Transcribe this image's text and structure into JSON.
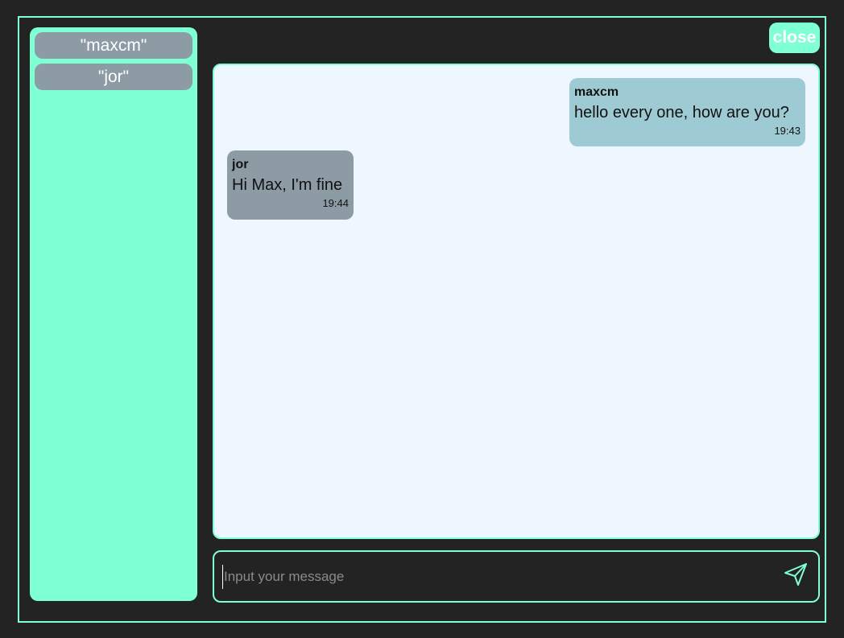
{
  "sidebar": {
    "users": [
      {
        "label": "\"maxcm\""
      },
      {
        "label": "\"jor\""
      }
    ]
  },
  "header": {
    "close_label": "close"
  },
  "messages": [
    {
      "sender": "maxcm",
      "text": "hello every one, how are you?",
      "time": "19:43"
    },
    {
      "sender": "jor",
      "text": "Hi Max, I'm fine",
      "time": "19:44"
    }
  ],
  "composer": {
    "placeholder": "Input your message",
    "send_icon": "send-icon"
  },
  "colors": {
    "background": "#232323",
    "accent": "#7fffd4",
    "chat_background": "#eef6ff",
    "own_message": "#9ecbd3",
    "other_message": "#8d9ba5"
  }
}
